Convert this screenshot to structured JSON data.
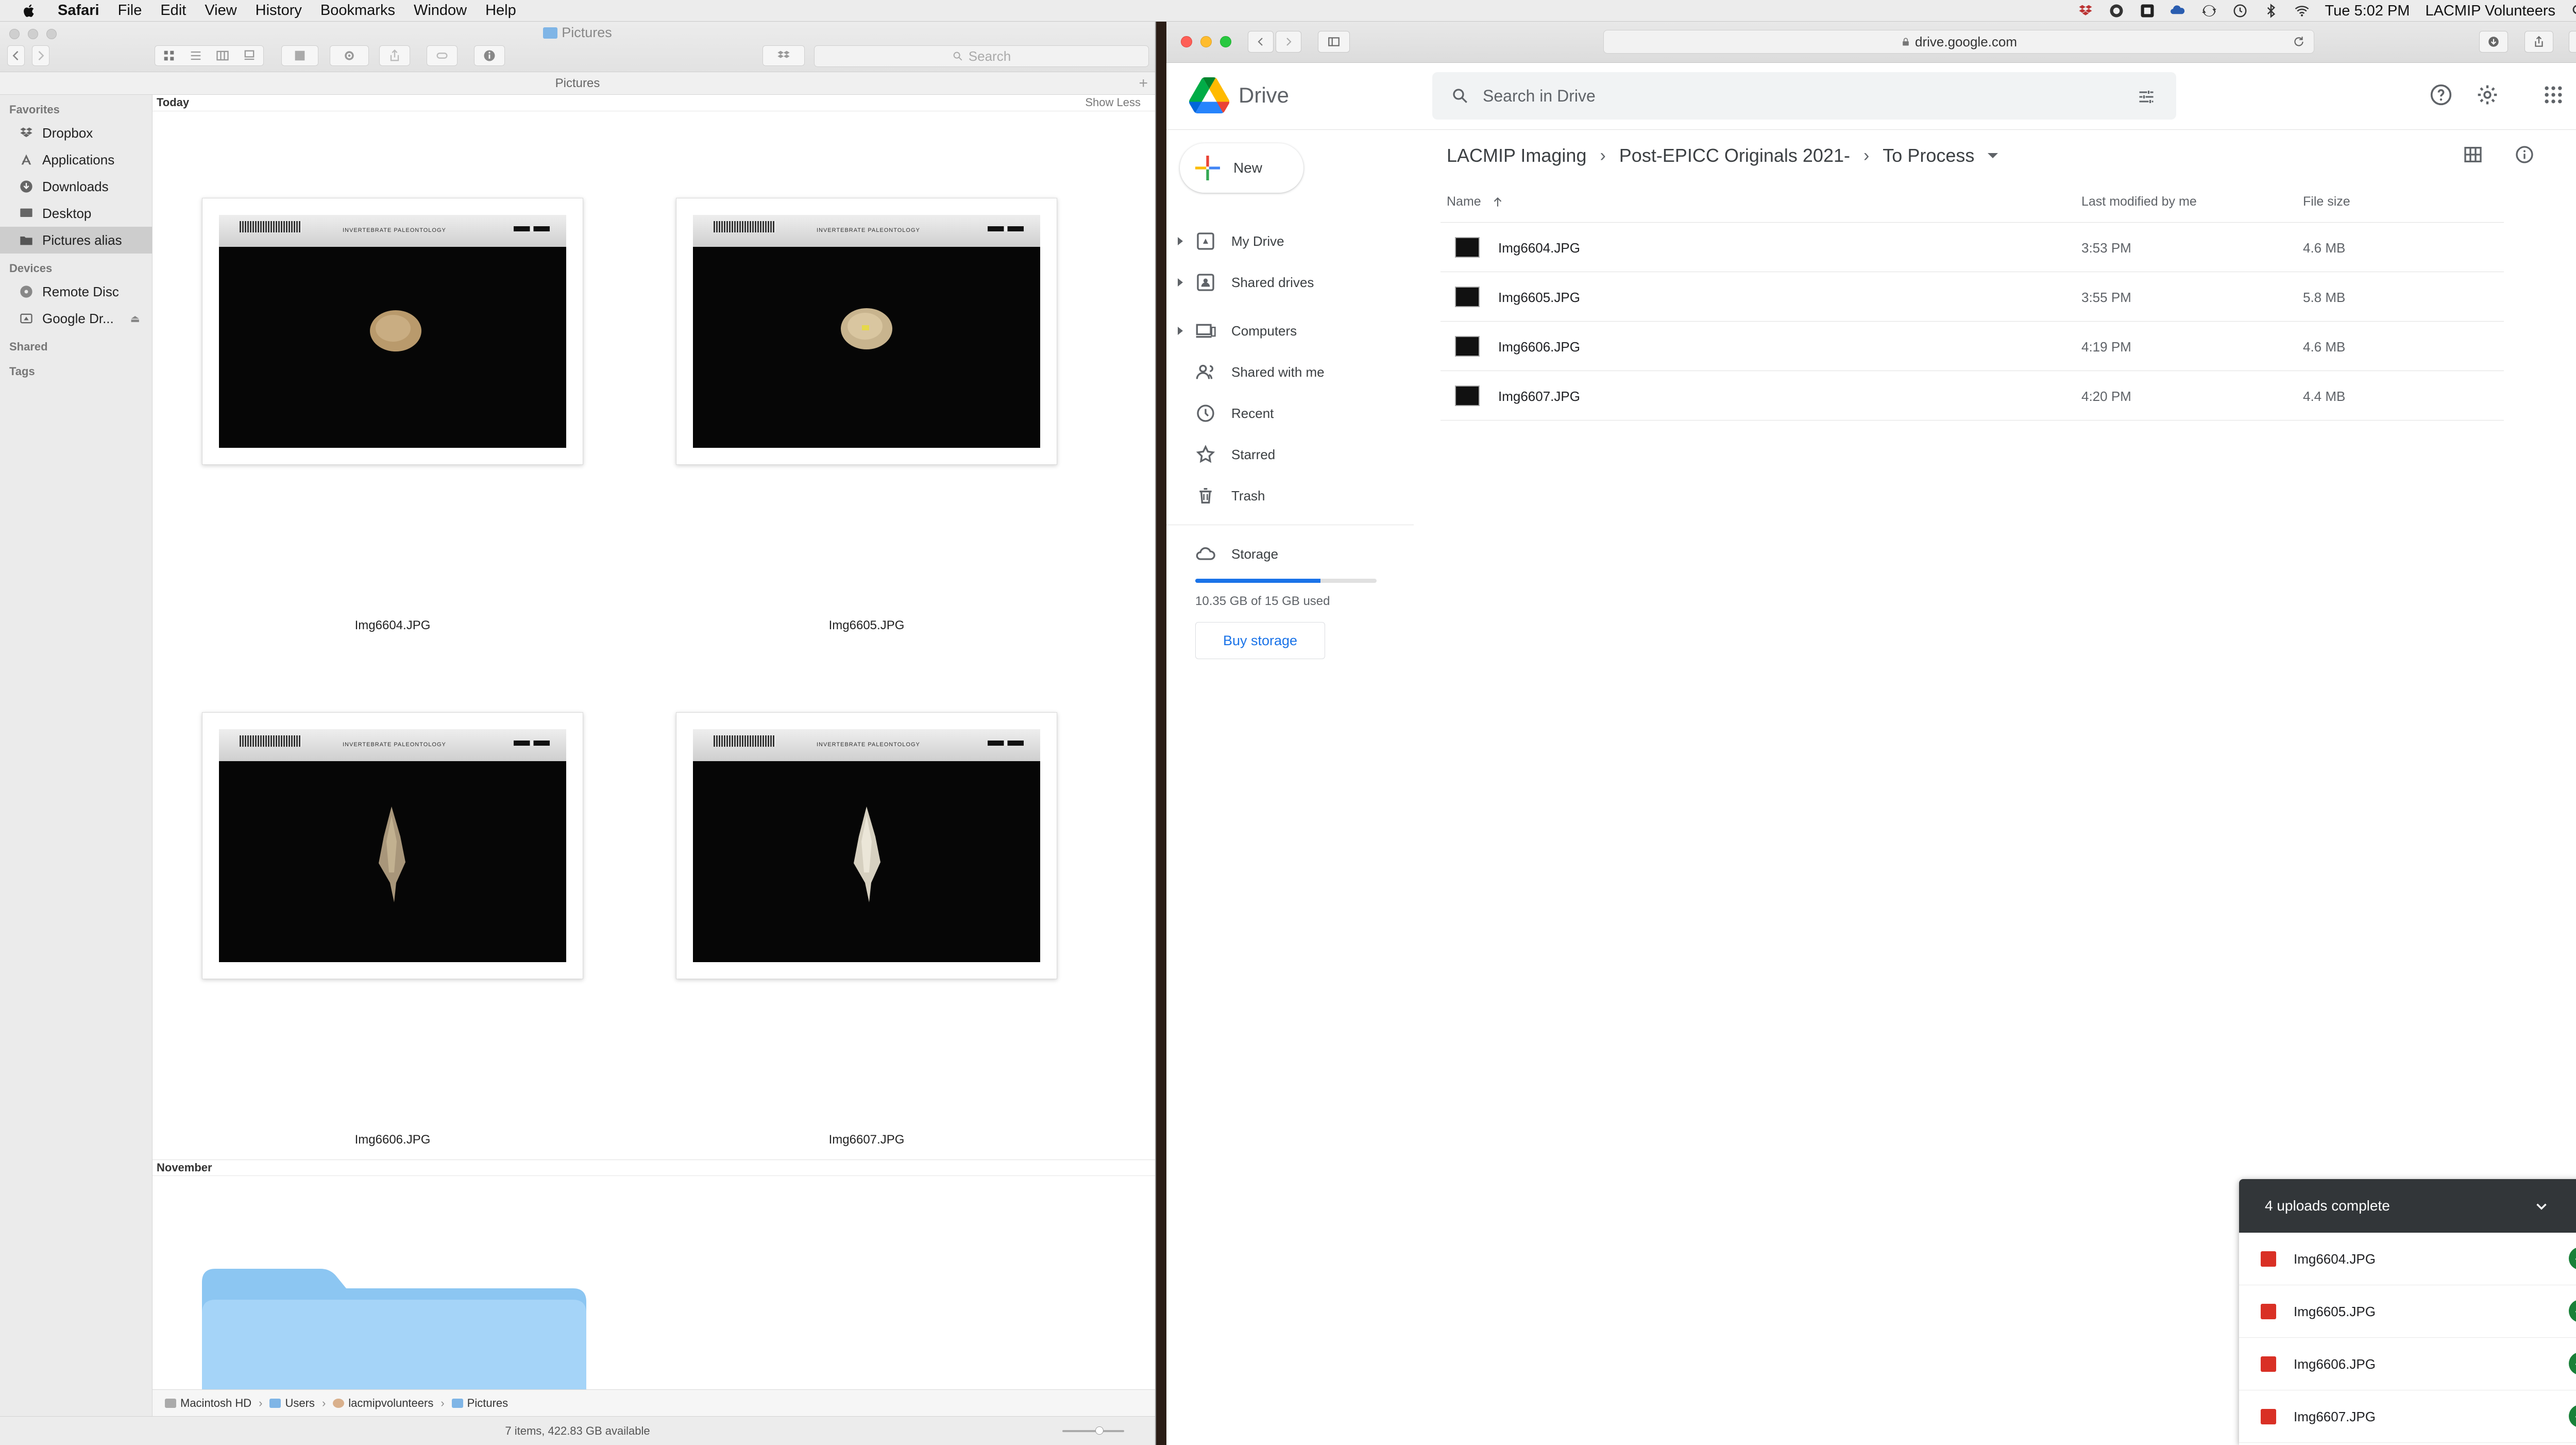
{
  "menubar": {
    "app": "Safari",
    "items": [
      "File",
      "Edit",
      "View",
      "History",
      "Bookmarks",
      "Window",
      "Help"
    ],
    "clock": "Tue 5:02 PM",
    "user": "LACMIP Volunteers"
  },
  "finder": {
    "title": "Pictures",
    "search_placeholder": "Search",
    "path_header": "Pictures",
    "sidebar": {
      "favorites_label": "Favorites",
      "favorites": [
        "Dropbox",
        "Applications",
        "Downloads",
        "Desktop",
        "Pictures alias"
      ],
      "devices_label": "Devices",
      "devices": [
        "Remote Disc",
        "Google Dr..."
      ],
      "shared_label": "Shared",
      "tags_label": "Tags"
    },
    "groups": {
      "today": "Today",
      "show_less": "Show Less",
      "november": "November"
    },
    "files": [
      "Img6604.JPG",
      "Img6605.JPG",
      "Img6606.JPG",
      "Img6607.JPG"
    ],
    "pathbar": [
      "Macintosh HD",
      "Users",
      "lacmipvolunteers",
      "Pictures"
    ],
    "status": "7 items, 422.83 GB available"
  },
  "safari": {
    "url": "drive.google.com"
  },
  "drive": {
    "brand": "Drive",
    "search_placeholder": "Search in Drive",
    "new_label": "New",
    "nav": [
      "My Drive",
      "Shared drives",
      "Computers",
      "Shared with me",
      "Recent",
      "Starred",
      "Trash"
    ],
    "storage_label": "Storage",
    "storage_used_text": "10.35 GB of 15 GB used",
    "storage_fraction": 0.69,
    "buy_storage": "Buy storage",
    "breadcrumb": [
      "LACMIP Imaging",
      "Post-EPICC Originals 2021-",
      "To Process"
    ],
    "columns": {
      "name": "Name",
      "modified": "Last modified by me",
      "size": "File size"
    },
    "files": [
      {
        "name": "Img6604.JPG",
        "modified": "3:53 PM",
        "size": "4.6 MB"
      },
      {
        "name": "Img6605.JPG",
        "modified": "3:55 PM",
        "size": "5.8 MB"
      },
      {
        "name": "Img6606.JPG",
        "modified": "4:19 PM",
        "size": "4.6 MB"
      },
      {
        "name": "Img6607.JPG",
        "modified": "4:20 PM",
        "size": "4.4 MB"
      }
    ]
  },
  "uploads": {
    "title": "4 uploads complete",
    "items": [
      "Img6604.JPG",
      "Img6605.JPG",
      "Img6606.JPG",
      "Img6607.JPG"
    ]
  },
  "colors": {
    "drive_blue": "#1a73e8",
    "upload_header": "#323639",
    "success_green": "#188038",
    "finder_selection": "#cdcdcd"
  }
}
